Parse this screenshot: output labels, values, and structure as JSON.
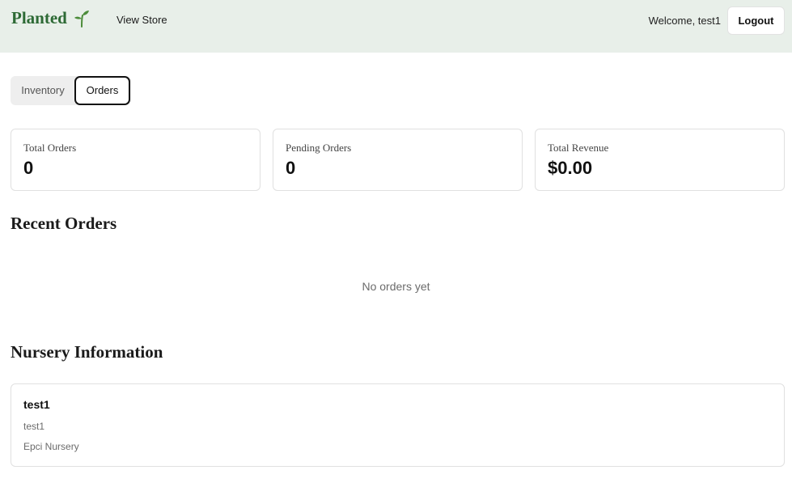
{
  "header": {
    "brand": "Planted",
    "view_store": "View Store",
    "welcome": "Welcome, test1",
    "logout": "Logout"
  },
  "tabs": [
    {
      "label": "Inventory",
      "active": false
    },
    {
      "label": "Orders",
      "active": true
    }
  ],
  "stats": [
    {
      "label": "Total Orders",
      "value": "0"
    },
    {
      "label": "Pending Orders",
      "value": "0"
    },
    {
      "label": "Total Revenue",
      "value": "$0.00"
    }
  ],
  "recent_orders": {
    "title": "Recent Orders",
    "empty_message": "No orders yet"
  },
  "nursery": {
    "title": "Nursery Information",
    "name": "test1",
    "line1": "test1",
    "line2": "Epci Nursery"
  },
  "colors": {
    "header_bg": "#e8efe9",
    "brand_green": "#2d6a35",
    "sprout_green": "#4c8c3a"
  }
}
